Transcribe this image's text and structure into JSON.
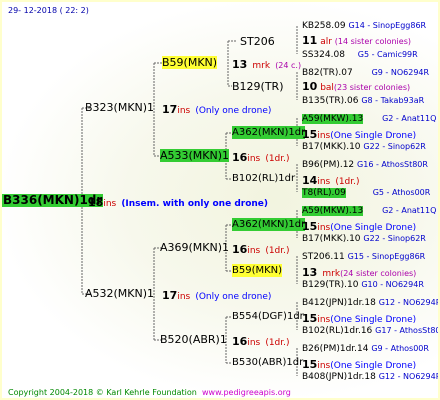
{
  "header": {
    "date": "29- 12-2018 ( 22:  2)"
  },
  "root": {
    "name": "B336(MKN)1dr",
    "count": "18",
    "ins": "ins",
    "note": "(Insem. with only one drone)"
  },
  "g1": [
    {
      "name": "B323(MKN)1",
      "count": "17",
      "ins": "ins",
      "note": "(Only one drone)"
    },
    {
      "name": "A532(MKN)1",
      "count": "17",
      "ins": "ins",
      "note": "(Only one drone)"
    }
  ],
  "g2": [
    {
      "name": "B59(MKN)",
      "count": "13",
      "ins": "mrk",
      "note": "(24 c.)"
    },
    {
      "name": "A533(MKN)1",
      "count": "16",
      "ins": "ins",
      "note": "(1dr.)"
    },
    {
      "name": "A369(MKN)1",
      "count": "16",
      "ins": "ins",
      "note": "(1dr.)"
    },
    {
      "name": "B520(ABR)1",
      "count": "16",
      "ins": "ins",
      "note": "(1dr.)"
    }
  ],
  "g3": [
    {
      "name": "ST206",
      "count": "",
      "ins": "",
      "note": ""
    },
    {
      "name": "B129(TR)",
      "count": "",
      "ins": "",
      "note": ""
    },
    {
      "name": "A362(MKN)1dr",
      "count": "15",
      "ins": "ins",
      "note": "(One Single Drone)"
    },
    {
      "name": "B102(RL)1dr",
      "count": "14",
      "ins": "ins",
      "note": "(1dr.)"
    },
    {
      "name": "A362(MKN)1dr",
      "count": "15",
      "ins": "ins",
      "note": "(One Single Drone)"
    },
    {
      "name": "B59(MKN)",
      "count": "13",
      "ins": "mrk",
      "note": "(24 sister colonies)"
    },
    {
      "name": "B554(DGF)1dr",
      "count": "15",
      "ins": "ins",
      "note": "(One Single Drone)"
    },
    {
      "name": "B530(ABR)1dr",
      "count": "15",
      "ins": "ins",
      "note": "(One Single Drone)"
    }
  ],
  "g4": [
    {
      "name": "KB258.09",
      "tag": "G14 - SinopEgg86R"
    },
    {
      "name": "11",
      "tag": "(14 sister colonies)",
      "mid": "alr"
    },
    {
      "name": "SS324.08",
      "tag": "G5 - Camic99R"
    },
    {
      "name": "B82(TR).07",
      "tag": "G9 - NO6294R"
    },
    {
      "name": "10",
      "tag": "(23 sister colonies)",
      "mid": "bal"
    },
    {
      "name": "B135(TR).06",
      "tag": "G8 - Takab93aR"
    },
    {
      "name": "A59(MKW).13",
      "tag": "G2 - Anat11Q"
    },
    {
      "name": "B17(MKK).10",
      "tag": "G22 - Sinop62R"
    },
    {
      "name": "B96(PM).12",
      "tag": "G16 - AthosSt80R"
    },
    {
      "name": "T8(RL).09",
      "tag": "G5 - Athos00R"
    },
    {
      "name": "A59(MKW).13",
      "tag": "G2 - Anat11Q"
    },
    {
      "name": "B17(MKK).10",
      "tag": "G22 - Sinop62R"
    },
    {
      "name": "ST206.11",
      "tag": "G15 - SinopEgg86R"
    },
    {
      "name": "B129(TR).10",
      "tag": "G10 - NO6294R"
    },
    {
      "name": "B412(JPN)1dr.18",
      "tag": "G12 - NO6294R"
    },
    {
      "name": "B102(RL)1dr.16",
      "tag": "G17 - AthosSt80R"
    },
    {
      "name": "B26(PM)1dr.14",
      "tag": "G9 - Athos00R"
    },
    {
      "name": "B408(JPN)1dr.18",
      "tag": "G12 - NO6294R"
    }
  ],
  "footer": {
    "copyright": "Copyright 2004-2018 © Karl Kehrle Foundation",
    "url": "www.pedigreeapis.org"
  }
}
